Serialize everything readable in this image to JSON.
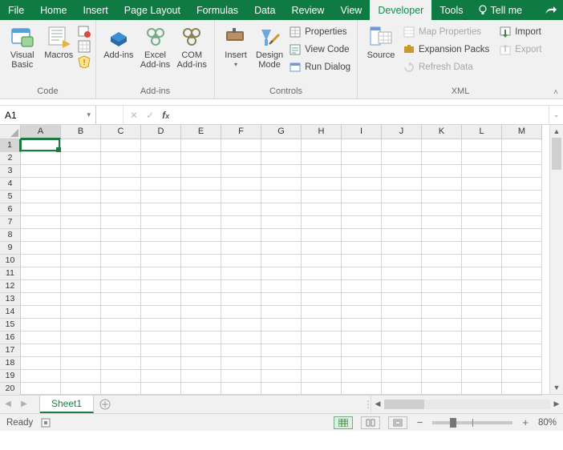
{
  "tabs": {
    "items": [
      "File",
      "Home",
      "Insert",
      "Page Layout",
      "Formulas",
      "Data",
      "Review",
      "View",
      "Developer",
      "Tools"
    ],
    "active": "Developer",
    "tell_me": "Tell me"
  },
  "ribbon": {
    "groups": {
      "code": {
        "label": "Code",
        "visual_basic": "Visual Basic",
        "macros": "Macros"
      },
      "addins": {
        "label": "Add-ins",
        "addins": "Add-ins",
        "excel": "Excel Add-ins",
        "com": "COM Add-ins"
      },
      "controls": {
        "label": "Controls",
        "insert": "Insert",
        "design": "Design Mode",
        "properties": "Properties",
        "view_code": "View Code",
        "run_dialog": "Run Dialog"
      },
      "xml": {
        "label": "XML",
        "source": "Source",
        "map_props": "Map Properties",
        "expansion": "Expansion Packs",
        "refresh": "Refresh Data",
        "import": "Import",
        "export": "Export"
      }
    }
  },
  "namebox": {
    "value": "A1"
  },
  "formula": {
    "value": ""
  },
  "columns": [
    "A",
    "B",
    "C",
    "D",
    "E",
    "F",
    "G",
    "H",
    "I",
    "J",
    "K",
    "L",
    "M"
  ],
  "rows": [
    "1",
    "2",
    "3",
    "4",
    "5",
    "6",
    "7",
    "8",
    "9",
    "10",
    "11",
    "12",
    "13",
    "14",
    "15",
    "16",
    "17",
    "18",
    "19",
    "20"
  ],
  "sheets": {
    "active": "Sheet1"
  },
  "status": {
    "mode": "Ready",
    "zoom": "80%"
  }
}
